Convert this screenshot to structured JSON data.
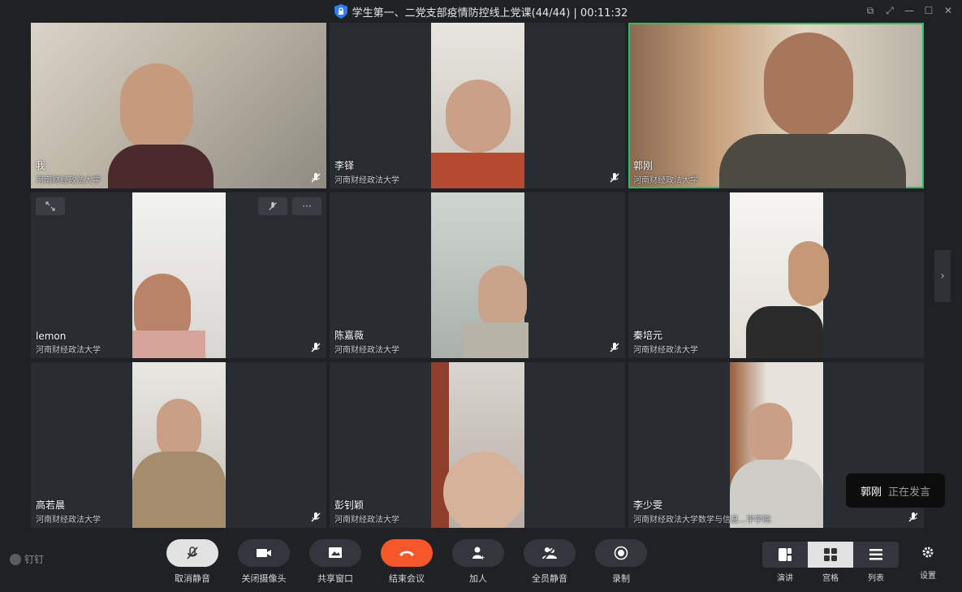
{
  "window": {
    "title": "学生第一、二党支部疫情防控线上党课(44/44) | 00:11:32"
  },
  "colors": {
    "accent_green": "#1fc46a",
    "end_red": "#f5572b"
  },
  "participants": [
    {
      "name": "我",
      "org": "河南财经政法大学",
      "muted": true,
      "active": false
    },
    {
      "name": "李铎",
      "org": "河南财经政法大学",
      "muted": true,
      "active": false
    },
    {
      "name": "郭刚",
      "org": "河南财经政法大学",
      "muted": false,
      "active": true
    },
    {
      "name": "lemon",
      "org": "河南财经政法大学",
      "muted": true,
      "active": false
    },
    {
      "name": "陈嘉薇",
      "org": "河南财经政法大学",
      "muted": true,
      "active": false
    },
    {
      "name": "秦培元",
      "org": "河南财经政法大学",
      "muted": false,
      "active": false
    },
    {
      "name": "高若晨",
      "org": "河南财经政法大学",
      "muted": true,
      "active": false
    },
    {
      "name": "彭钊颖",
      "org": "河南财经政法大学",
      "muted": false,
      "active": false
    },
    {
      "name": "李少雯",
      "org": "河南财经政法大学数学与信息...学学院",
      "muted": true,
      "active": false
    }
  ],
  "tile_controls": {
    "fullscreen_icon": "expand-icon",
    "mute_icon": "mic-off-icon",
    "more_label": "···"
  },
  "speaking": {
    "who": "郭刚",
    "status": "正在发言"
  },
  "brand": {
    "label": "钉钉"
  },
  "toolbar": {
    "unmute": "取消静音",
    "camera_off": "关闭摄像头",
    "share": "共享窗口",
    "end": "结束会议",
    "add": "加人",
    "mute_all": "全员静音",
    "record": "录制"
  },
  "views": {
    "speaker": "演讲",
    "grid": "宫格",
    "list": "列表",
    "settings": "设置"
  }
}
